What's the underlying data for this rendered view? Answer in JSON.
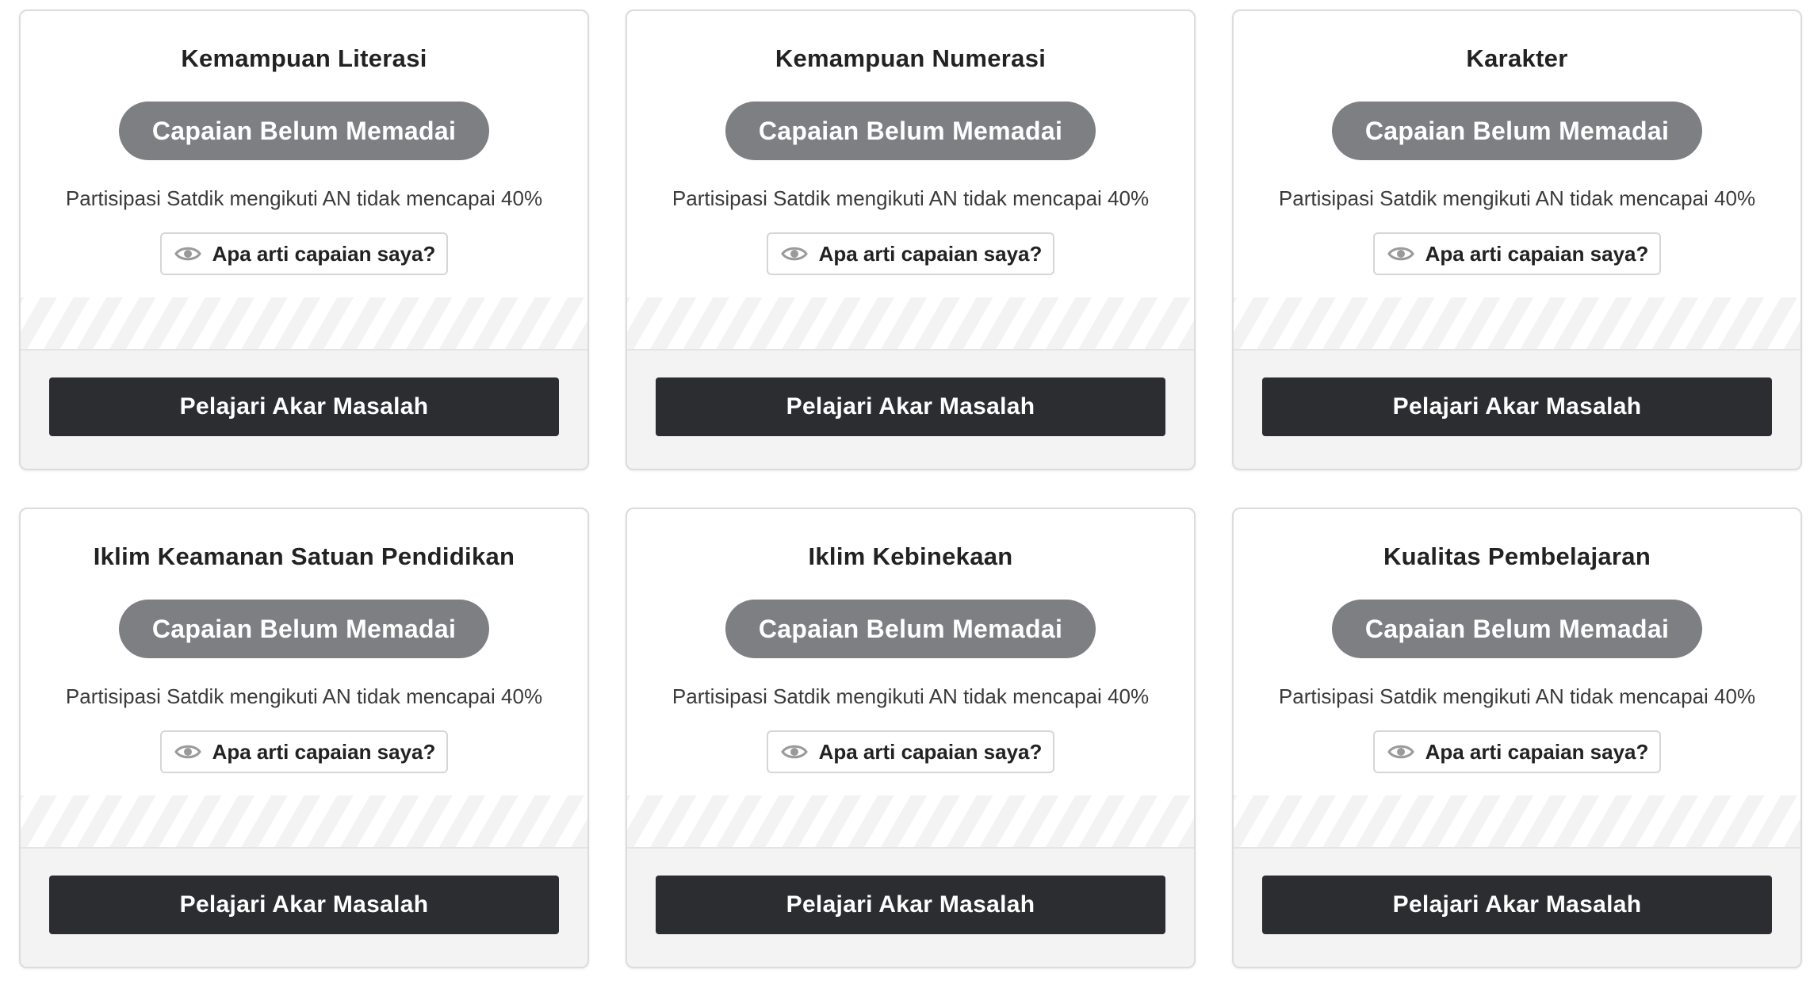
{
  "colors": {
    "badge_bg": "#7d7f83",
    "cta_bg": "#2b2d30",
    "eye_icon": "#9a9a9a"
  },
  "cards": [
    {
      "title": "Kemampuan Literasi",
      "badge": "Capaian Belum Memadai",
      "description": "Partisipasi Satdik mengikuti AN tidak mencapai 40%",
      "info_label": "Apa arti capaian saya?",
      "info_icon": "eye-icon",
      "cta_label": "Pelajari Akar Masalah"
    },
    {
      "title": "Kemampuan Numerasi",
      "badge": "Capaian Belum Memadai",
      "description": "Partisipasi Satdik mengikuti AN tidak mencapai 40%",
      "info_label": "Apa arti capaian saya?",
      "info_icon": "eye-icon",
      "cta_label": "Pelajari Akar Masalah"
    },
    {
      "title": "Karakter",
      "badge": "Capaian Belum Memadai",
      "description": "Partisipasi Satdik mengikuti AN tidak mencapai 40%",
      "info_label": "Apa arti capaian saya?",
      "info_icon": "eye-icon",
      "cta_label": "Pelajari Akar Masalah"
    },
    {
      "title": "Iklim Keamanan Satuan Pendidikan",
      "badge": "Capaian Belum Memadai",
      "description": "Partisipasi Satdik mengikuti AN tidak mencapai 40%",
      "info_label": "Apa arti capaian saya?",
      "info_icon": "eye-icon",
      "cta_label": "Pelajari Akar Masalah"
    },
    {
      "title": "Iklim Kebinekaan",
      "badge": "Capaian Belum Memadai",
      "description": "Partisipasi Satdik mengikuti AN tidak mencapai 40%",
      "info_label": "Apa arti capaian saya?",
      "info_icon": "eye-icon",
      "cta_label": "Pelajari Akar Masalah"
    },
    {
      "title": "Kualitas Pembelajaran",
      "badge": "Capaian Belum Memadai",
      "description": "Partisipasi Satdik mengikuti AN tidak mencapai 40%",
      "info_label": "Apa arti capaian saya?",
      "info_icon": "eye-icon",
      "cta_label": "Pelajari Akar Masalah"
    }
  ]
}
